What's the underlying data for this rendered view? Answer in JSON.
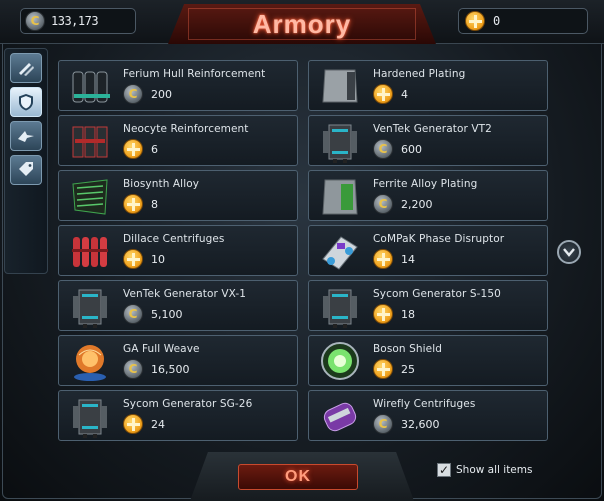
{
  "header": {
    "title": "Armory",
    "credits": "133,173",
    "premium": "0",
    "credit_symbol": "C"
  },
  "side_tabs": [
    {
      "icon": "weapons-icon",
      "active": false
    },
    {
      "icon": "shield-icon",
      "active": true
    },
    {
      "icon": "ship-icon",
      "active": false
    },
    {
      "icon": "tag-icon",
      "active": false
    }
  ],
  "items": [
    {
      "name": "Ferium Hull Reinforcement",
      "currency": "credits",
      "price": "200",
      "thumb": "hull-reinforcement-icon"
    },
    {
      "name": "Hardened Plating",
      "currency": "premium",
      "price": "4",
      "thumb": "plating-icon"
    },
    {
      "name": "Neocyte Reinforcement",
      "currency": "premium",
      "price": "6",
      "thumb": "reinforcement-icon"
    },
    {
      "name": "VenTek Generator VT2",
      "currency": "credits",
      "price": "600",
      "thumb": "generator-icon"
    },
    {
      "name": "Biosynth Alloy",
      "currency": "premium",
      "price": "8",
      "thumb": "alloy-icon"
    },
    {
      "name": "Ferrite Alloy Plating",
      "currency": "credits",
      "price": "2,200",
      "thumb": "alloy-plating-icon"
    },
    {
      "name": "Dillace Centrifuges",
      "currency": "premium",
      "price": "10",
      "thumb": "centrifuges-icon"
    },
    {
      "name": "CoMPaK Phase Disruptor",
      "currency": "premium",
      "price": "14",
      "thumb": "phase-disruptor-icon"
    },
    {
      "name": "VenTek Generator VX-1",
      "currency": "credits",
      "price": "5,100",
      "thumb": "generator-icon"
    },
    {
      "name": "Sycom Generator S-150",
      "currency": "premium",
      "price": "18",
      "thumb": "generator-icon"
    },
    {
      "name": "GA Full Weave",
      "currency": "credits",
      "price": "16,500",
      "thumb": "weave-orb-icon"
    },
    {
      "name": "Boson Shield",
      "currency": "premium",
      "price": "25",
      "thumb": "boson-shield-icon"
    },
    {
      "name": "Sycom Generator SG-26",
      "currency": "premium",
      "price": "24",
      "thumb": "generator-icon"
    },
    {
      "name": "Wirefly Centrifuges",
      "currency": "credits",
      "price": "32,600",
      "thumb": "centrifuge-canister-icon"
    }
  ],
  "footer": {
    "ok_label": "OK",
    "show_all_label": "Show all items",
    "show_all_checked": true
  },
  "colors": {
    "accent_red": "#ff5a33",
    "premium_gold": "#f0a11b",
    "panel_border": "#4d6070"
  }
}
